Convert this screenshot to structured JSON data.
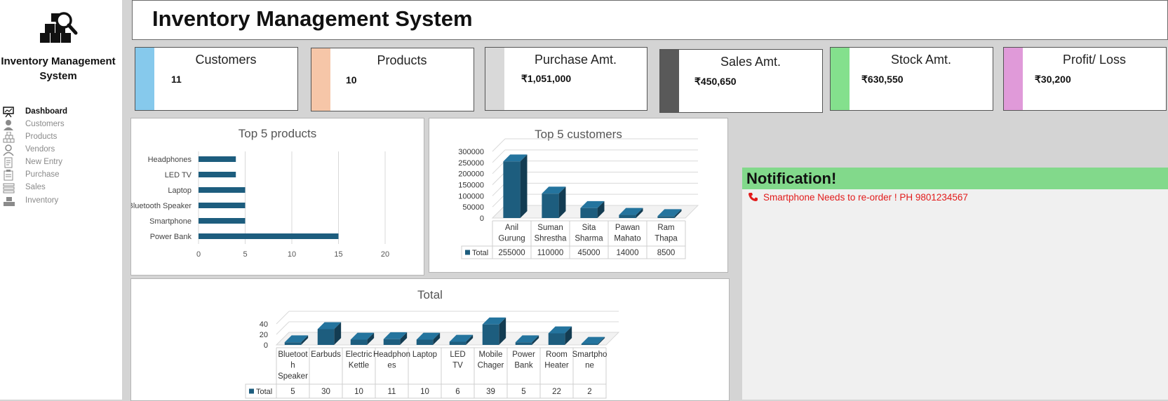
{
  "sidebar": {
    "app_name": "Inventory Management System",
    "logo_icon": "boxes-magnifier-icon",
    "items": [
      {
        "label": "Dashboard",
        "icon": "presentation-icon",
        "active": true
      },
      {
        "label": "Customers",
        "icon": "user-icon",
        "active": false
      },
      {
        "label": "Products",
        "icon": "boxes-icon",
        "active": false
      },
      {
        "label": "Vendors",
        "icon": "vendor-icon",
        "active": false
      },
      {
        "label": "New Entry",
        "icon": "document-icon",
        "active": false
      },
      {
        "label": "Purchase",
        "icon": "clipboard-icon",
        "active": false
      },
      {
        "label": "Sales",
        "icon": "register-icon",
        "active": false
      },
      {
        "label": "Inventory",
        "icon": "inventory-icon",
        "active": false
      }
    ]
  },
  "header": {
    "title": "Inventory Management System"
  },
  "kpis": [
    {
      "title": "Customers",
      "value": "11",
      "color": "#86c9ec"
    },
    {
      "title": "Products",
      "value": "10",
      "color": "#f6c6a8"
    },
    {
      "title": "Purchase Amt.",
      "value": "₹1,051,000",
      "color": "#d9d9d9"
    },
    {
      "title": "Sales Amt.",
      "value": "₹450,650",
      "color": "#595959"
    },
    {
      "title": "Stock Amt.",
      "value": "₹630,550",
      "color": "#84e08d"
    },
    {
      "title": "Profit/ Loss",
      "value": "₹30,200",
      "color": "#e09ad9"
    }
  ],
  "notification": {
    "title": "Notification!",
    "message": "Smartphone Needs to re-order  ! PH 9801234567",
    "icon": "phone-icon",
    "bar_color": "#82d98b",
    "text_color": "#e21b1b"
  },
  "chart_data": [
    {
      "type": "bar",
      "orientation": "horizontal",
      "title": "Top 5 products",
      "categories": [
        "Headphones",
        "LED TV",
        "Laptop",
        "Bluetooth Speaker",
        "Smartphone",
        "Power Bank"
      ],
      "values": [
        4,
        4,
        5,
        5,
        5,
        15
      ],
      "xlim": [
        0,
        20
      ],
      "xticks": [
        "0",
        "5",
        "10",
        "15",
        "20"
      ],
      "grid": true,
      "bar_color": "#1d5d7e"
    },
    {
      "type": "bar",
      "style": "3d-column",
      "title": "Top 5 customers",
      "categories": [
        "Anil Gurung",
        "Suman Shrestha",
        "Sita Sharma",
        "Pawan Mahato",
        "Ram Thapa"
      ],
      "series": [
        {
          "name": "Total",
          "values": [
            255000,
            110000,
            45000,
            14000,
            8500
          ]
        }
      ],
      "ylim": [
        0,
        300000
      ],
      "yticks": [
        "0",
        "50000",
        "100000",
        "150000",
        "200000",
        "250000",
        "300000"
      ],
      "data_table": true,
      "bar_color": "#1d5d7e"
    },
    {
      "type": "bar",
      "style": "3d-column",
      "title": "Total",
      "categories": [
        "Bluetooth Speaker",
        "Earbuds",
        "Electric Kettle",
        "Headphones",
        "Laptop",
        "LED TV",
        "Mobile Chager",
        "Power Bank",
        "Room Heater",
        "Smartphone"
      ],
      "series": [
        {
          "name": "Total",
          "values": [
            5,
            30,
            10,
            11,
            10,
            6,
            39,
            5,
            22,
            2
          ]
        }
      ],
      "ylim": [
        0,
        40
      ],
      "yticks": [
        "0",
        "20",
        "40"
      ],
      "data_table": true,
      "bar_color": "#1d5d7e"
    }
  ]
}
